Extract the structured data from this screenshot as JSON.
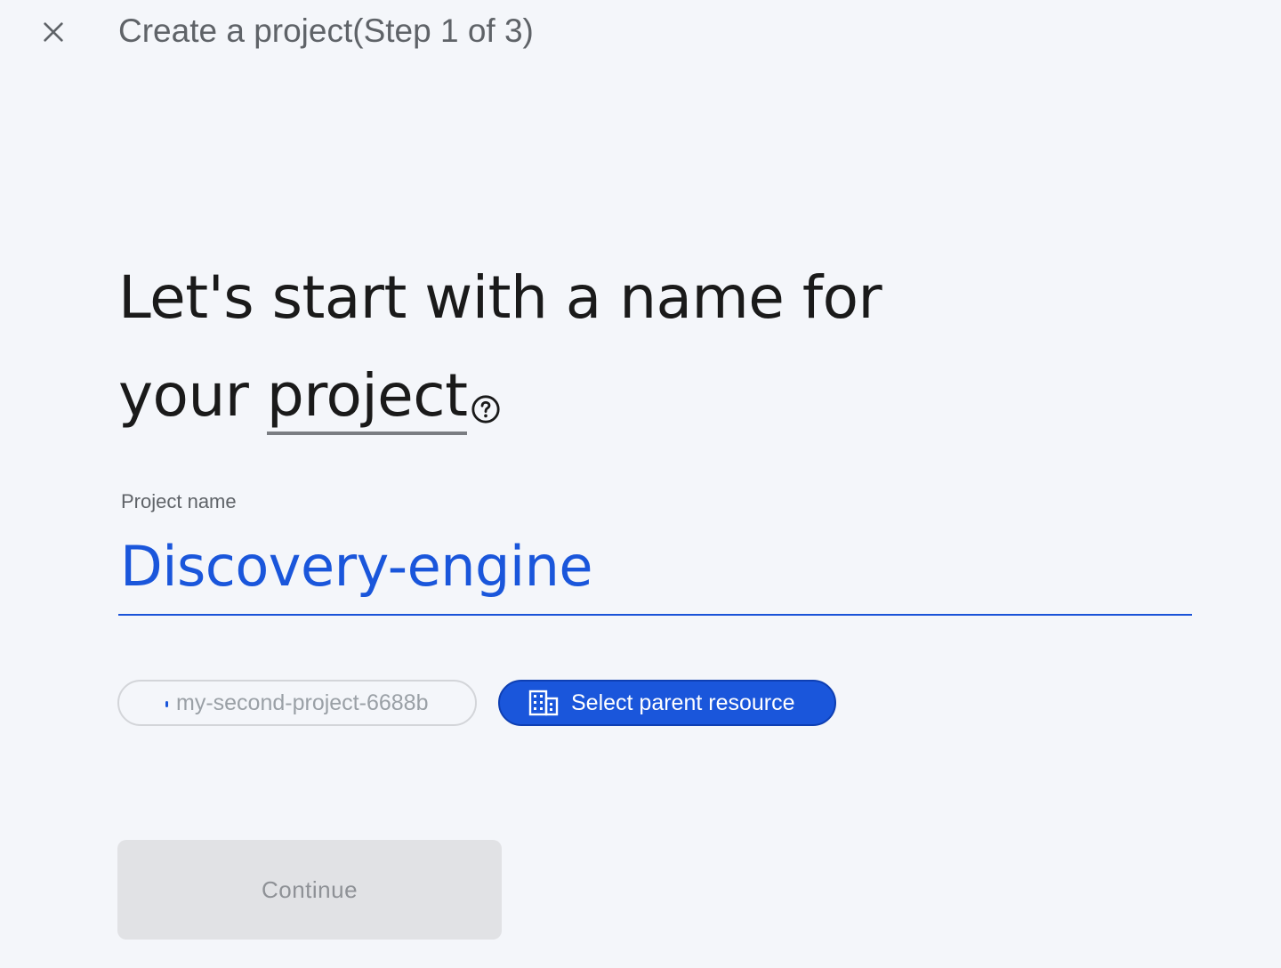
{
  "header": {
    "close_icon": "close-icon",
    "title": "Create a project(Step 1 of 3)"
  },
  "heading": {
    "line1": "Let's start with a name for",
    "line2_prefix": "your ",
    "term": "project",
    "help_icon": "help-circle-icon"
  },
  "project_name": {
    "label": "Project name",
    "value": "Discovery-engine"
  },
  "project_id_chip": {
    "text": "my-second-project-6688b"
  },
  "parent_button": {
    "icon": "building-icon",
    "label": "Select parent resource"
  },
  "continue_button": {
    "label": "Continue",
    "disabled": true
  },
  "colors": {
    "accent": "#1a56db",
    "background": "#f4f6fa",
    "disabled_bg": "#e1e2e5"
  }
}
